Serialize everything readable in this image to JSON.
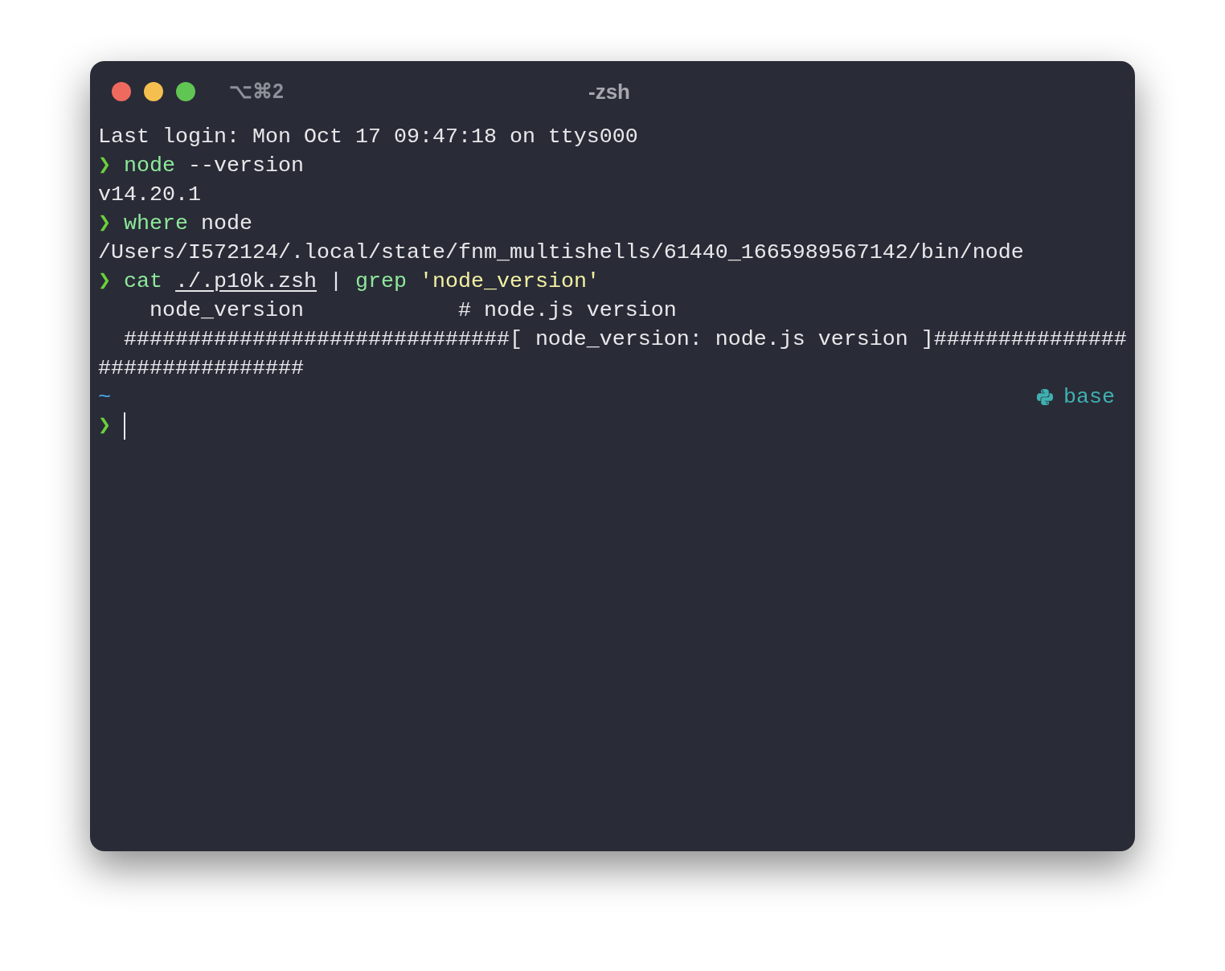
{
  "window": {
    "shortcut": "⌥⌘2",
    "title": "-zsh"
  },
  "lines": [
    {
      "segments": [
        {
          "kind": "plain",
          "text": "Last login: Mon Oct 17 09:47:18 on ttys000"
        }
      ]
    },
    {
      "segments": [
        {
          "kind": "prompt",
          "text": "❯ "
        },
        {
          "kind": "command",
          "text": "node"
        },
        {
          "kind": "plain",
          "text": " --version"
        }
      ]
    },
    {
      "segments": [
        {
          "kind": "plain",
          "text": "v14.20.1"
        }
      ]
    },
    {
      "segments": [
        {
          "kind": "prompt",
          "text": "❯ "
        },
        {
          "kind": "command",
          "text": "where"
        },
        {
          "kind": "plain",
          "text": " node"
        }
      ]
    },
    {
      "segments": [
        {
          "kind": "plain",
          "text": "/Users/I572124/.local/state/fnm_multishells/61440_1665989567142/bin/node"
        }
      ]
    },
    {
      "segments": [
        {
          "kind": "prompt",
          "text": "❯ "
        },
        {
          "kind": "command",
          "text": "cat "
        },
        {
          "kind": "path",
          "text": "./.p10k.zsh"
        },
        {
          "kind": "plain",
          "text": " | "
        },
        {
          "kind": "command",
          "text": "grep "
        },
        {
          "kind": "string",
          "text": "'node_version'"
        }
      ]
    },
    {
      "segments": [
        {
          "kind": "plain",
          "text": "    node_version            # node.js version"
        }
      ]
    },
    {
      "segments": [
        {
          "kind": "plain",
          "text": "  ##############################[ node_version: node.js version ]###############"
        }
      ]
    },
    {
      "segments": [
        {
          "kind": "plain",
          "text": "################"
        }
      ]
    },
    {
      "segments": [
        {
          "kind": "dir",
          "text": "~"
        }
      ],
      "status": {
        "env": "base"
      }
    },
    {
      "segments": [
        {
          "kind": "prompt",
          "text": "❯ "
        }
      ],
      "cursor": true
    }
  ]
}
